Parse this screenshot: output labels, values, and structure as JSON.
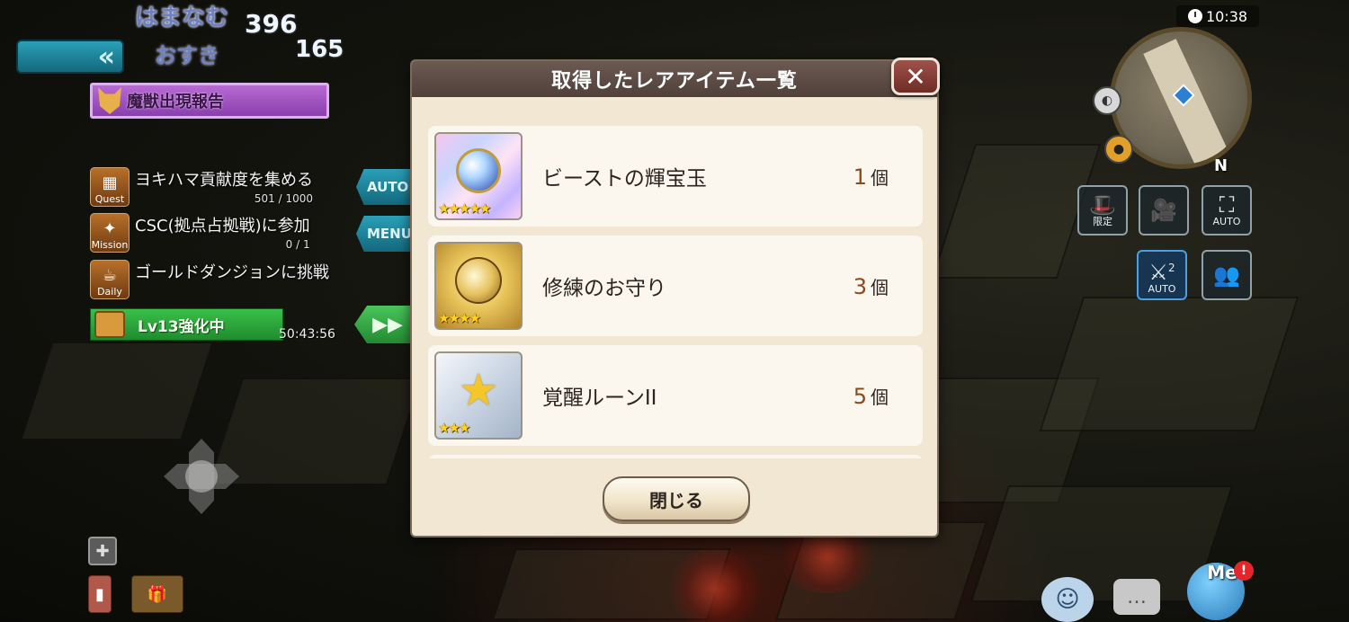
{
  "hud": {
    "clock_time": "10:38",
    "player_name": "はまなむ",
    "player_sub": "おすき",
    "stat_top": "396",
    "stat_bottom": "165",
    "back_glyph": "«",
    "report_banner": "魔獣出現報告",
    "quests": [
      {
        "category": "Quest",
        "title": "ヨキハマ貢献度を集める",
        "progress": "501 / 1000"
      },
      {
        "category": "Mission",
        "title": "CSC(拠点占拠戦)に参加",
        "progress": "0 / 1"
      },
      {
        "category": "Daily",
        "title": "ゴールドダンジョンに挑戦",
        "progress": ""
      }
    ],
    "enhance": {
      "label": "Lv13強化中",
      "timer": "50:43:56"
    },
    "side_tabs": {
      "auto": "AUTO",
      "menu": "MENU",
      "fast_forward": "▶▶"
    },
    "compass": "N",
    "right_buttons": {
      "limited": "限定",
      "auto": "AUTO",
      "auto2": "AUTO",
      "auto2_multiplier": "2"
    },
    "me_label": "Me"
  },
  "modal": {
    "title": "取得したレアアイテム一覧",
    "close_x": "✕",
    "close_button": "閉じる",
    "items": [
      {
        "name": "ビーストの輝宝玉",
        "qty": "1",
        "unit": "個",
        "stars": "★★★★★",
        "thumb": "holo"
      },
      {
        "name": "修練のお守り",
        "qty": "3",
        "unit": "個",
        "stars": "★★★★",
        "thumb": "gold"
      },
      {
        "name": "覚醒ルーンII",
        "qty": "5",
        "unit": "個",
        "stars": "★★★",
        "thumb": "silver"
      }
    ]
  },
  "colors": {
    "modal_bg": "#f1e7d3",
    "header_bg": "#5c4b44",
    "qty_color": "#8a4a1e",
    "accent_teal": "#1f8aa0",
    "accent_green": "#2aa63a"
  }
}
